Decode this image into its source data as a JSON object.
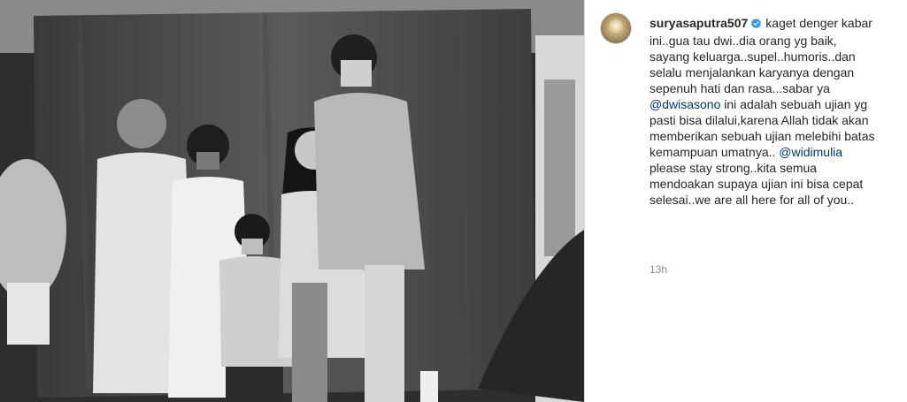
{
  "post": {
    "username": "suryasaputra507",
    "caption_segments": [
      {
        "type": "text",
        "value": "kaget denger kabar ini..gua tau dwi..dia orang yg baik, sayang keluarga..supel..humoris..dan selalu menjalankan karyanya dengan sepenuh hati dan rasa...sabar ya "
      },
      {
        "type": "mention",
        "value": "@dwisasono"
      },
      {
        "type": "text",
        "value": " ini adalah sebuah ujian yg pasti bisa dilalui,karena Allah tidak akan memberikan sebuah ujian melebihi batas kemampuan umatnya.. "
      },
      {
        "type": "mention",
        "value": "@widimulia"
      },
      {
        "type": "text",
        "value": " please stay strong..kita semua mendoakan supaya ujian ini bisa cepat selesai..we are all here for all of you.."
      }
    ],
    "timestamp": "13h"
  },
  "colors": {
    "verified_badge": "#3897f0",
    "mention": "#00376b",
    "text": "#262626",
    "muted": "#8e8e8e"
  },
  "icons": {
    "verified": "verified-badge-icon"
  }
}
